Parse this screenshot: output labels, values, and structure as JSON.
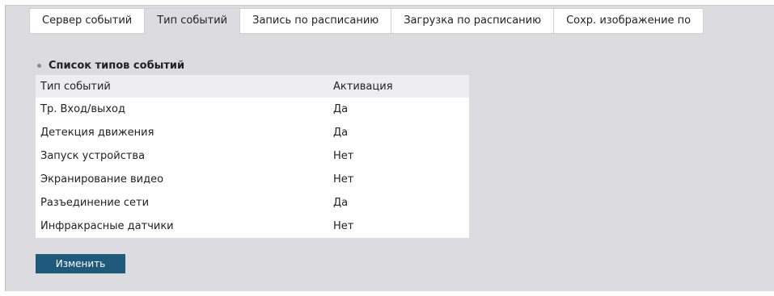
{
  "tabs": [
    {
      "label": "Сервер событий",
      "active": false
    },
    {
      "label": "Тип событий",
      "active": true
    },
    {
      "label": "Запись по расписанию",
      "active": false
    },
    {
      "label": "Загрузка по расписанию",
      "active": false
    },
    {
      "label": "Сохр. изображение по",
      "active": false
    }
  ],
  "section": {
    "title": "Список типов событий"
  },
  "table": {
    "headers": {
      "type": "Тип событий",
      "activation": "Активация"
    },
    "rows": [
      {
        "type": "Тр. Вход/выход",
        "activation": "Да"
      },
      {
        "type": "Детекция движения",
        "activation": "Да"
      },
      {
        "type": "Запуск устройства",
        "activation": "Нет"
      },
      {
        "type": "Экранирование видео",
        "activation": "Нет"
      },
      {
        "type": "Разъединение сети",
        "activation": "Да"
      },
      {
        "type": "Инфракрасные датчики",
        "activation": "Нет"
      }
    ]
  },
  "actions": {
    "edit_label": "Изменить"
  },
  "colors": {
    "panel_bg": "#dcdbe0",
    "button_bg": "#1f5a7d",
    "header_bg": "#eeeef0"
  }
}
